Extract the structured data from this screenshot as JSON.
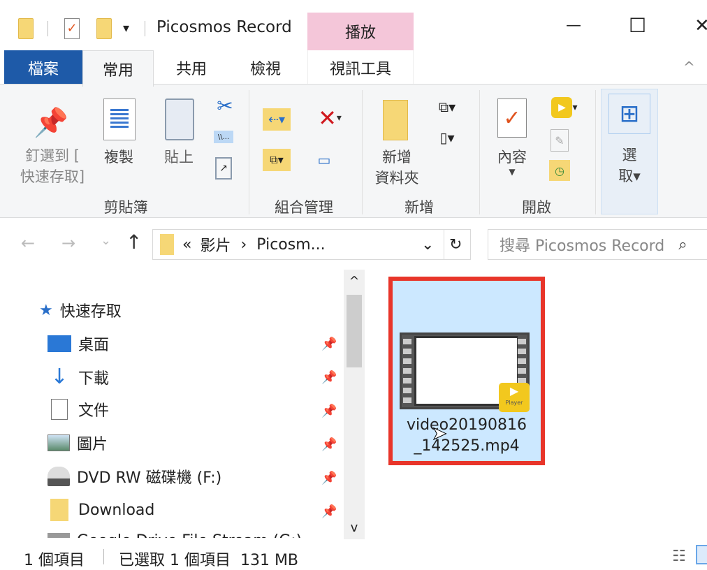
{
  "titlebar": {
    "title": "Picosmos Record",
    "context_tab": "播放",
    "minimize": "—",
    "maximize": "☐",
    "close": "✕",
    "qat_dropdown": "▾"
  },
  "tabs": [
    {
      "label": "檔案"
    },
    {
      "label": "常用"
    },
    {
      "label": "共用"
    },
    {
      "label": "檢視"
    },
    {
      "label": "視訊工具"
    }
  ],
  "ribbon_collapse": "^",
  "ribbon": {
    "clipboard": {
      "group": "剪貼簿",
      "pin_line1": "釘選到 [",
      "pin_line2": "快速存取]",
      "copy": "複製",
      "paste": "貼上"
    },
    "organize": {
      "group": "組合管理"
    },
    "new": {
      "group": "新增",
      "new_folder_line1": "新增",
      "new_folder_line2": "資料夾"
    },
    "open": {
      "group": "開啟",
      "properties": "內容"
    },
    "select": {
      "line1": "選",
      "line2": "取▾"
    }
  },
  "address": {
    "back": "←",
    "forward": "→",
    "recent": "⌄",
    "up": "↑",
    "prefix": "«",
    "crumb1": "影片",
    "chevron": "›",
    "crumb2": "Picosm...",
    "dropdown": "⌄",
    "refresh": "↻"
  },
  "search": {
    "placeholder": "搜尋 Picosmos Record",
    "icon": "⌕"
  },
  "sidebar": {
    "quick_access": "快速存取",
    "items": [
      {
        "label": "桌面",
        "icon": "desktop-icon"
      },
      {
        "label": "下載",
        "icon": "download-icon"
      },
      {
        "label": "文件",
        "icon": "document-icon"
      },
      {
        "label": "圖片",
        "icon": "pictures-icon"
      },
      {
        "label": "DVD RW 磁碟機 (F:)",
        "icon": "dvd-drive-icon"
      },
      {
        "label": "Download",
        "icon": "folder-icon"
      },
      {
        "label": "Google Drive File Stream (G:)",
        "icon": "drive-icon"
      }
    ],
    "scroll_up": "^",
    "scroll_down": "v"
  },
  "file": {
    "name_line1": "video20190816",
    "name_line2": "_142525.mp4",
    "badge": "Player",
    "highlight_color": "#e8352a",
    "selected_bg": "#cce8ff"
  },
  "status": {
    "count": "1 個項目",
    "selection": "已選取 1 個項目  131 MB"
  },
  "colors": {
    "file_tab": "#1e5aa8",
    "context_tab": "#f4c6d9"
  }
}
